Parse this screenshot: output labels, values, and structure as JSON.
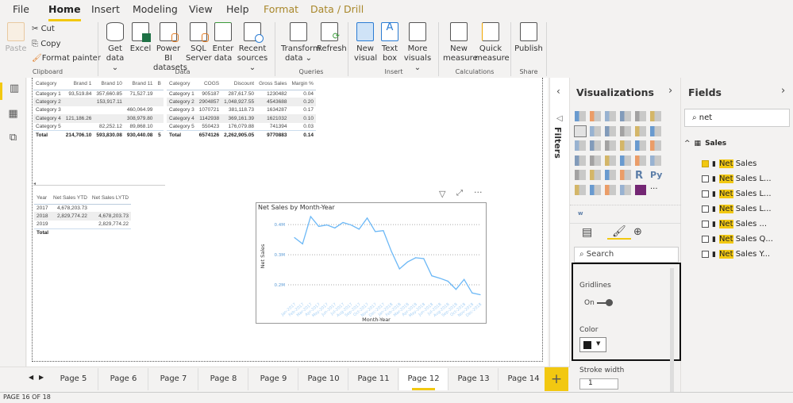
{
  "ribbon": {
    "tabs": [
      "File",
      "Home",
      "Insert",
      "Modeling",
      "View",
      "Help",
      "Format",
      "Data / Drill"
    ],
    "paste": "Paste",
    "cut": "Cut",
    "copy": "Copy",
    "format_painter": "Format painter",
    "buttons": [
      {
        "l1": "Get",
        "l2": "data ⌄"
      },
      {
        "l1": "Excel",
        "l2": ""
      },
      {
        "l1": "Power BI",
        "l2": "datasets"
      },
      {
        "l1": "SQL",
        "l2": "Server"
      },
      {
        "l1": "Enter",
        "l2": "data"
      },
      {
        "l1": "Recent",
        "l2": "sources ⌄"
      },
      {
        "l1": "Transform",
        "l2": "data ⌄"
      },
      {
        "l1": "Refresh",
        "l2": ""
      },
      {
        "l1": "New",
        "l2": "visual"
      },
      {
        "l1": "Text",
        "l2": "box"
      },
      {
        "l1": "More",
        "l2": "visuals ⌄"
      },
      {
        "l1": "New",
        "l2": "measure"
      },
      {
        "l1": "Quick",
        "l2": "measure"
      },
      {
        "l1": "Publish",
        "l2": ""
      }
    ],
    "groups": [
      "Clipboard",
      "Data",
      "Queries",
      "Insert",
      "Calculations",
      "Share"
    ]
  },
  "table1": {
    "headers": [
      "Category",
      "Brand 1",
      "Brand 10",
      "Brand 11",
      "B"
    ],
    "rows": [
      [
        "Category 1",
        "93,519.84",
        "357,660.85",
        "71,527.19",
        ""
      ],
      [
        "Category 2",
        "",
        "153,917.11",
        "",
        ""
      ],
      [
        "Category 3",
        "",
        "",
        "460,064.99",
        ""
      ],
      [
        "Category 4",
        "121,186.26",
        "",
        "308,979.80",
        ""
      ],
      [
        "Category 5",
        "",
        "82,252.12",
        "89,868.10",
        ""
      ],
      [
        "Total",
        "214,706.10",
        "593,830.08",
        "930,440.08",
        "5"
      ]
    ]
  },
  "table2": {
    "headers": [
      "Category",
      "COGS",
      "Discount",
      "Gross Sales",
      "Margin %"
    ],
    "rows": [
      [
        "Category 1",
        "905187",
        "287,617.50",
        "1230482",
        "0.04"
      ],
      [
        "Category 2",
        "2904857",
        "1,048,927.55",
        "4543688",
        "0.20"
      ],
      [
        "Category 3",
        "1070721",
        "381,118.73",
        "1634287",
        "0.17"
      ],
      [
        "Category 4",
        "1142938",
        "369,161.39",
        "1621032",
        "0.10"
      ],
      [
        "Category 5",
        "550423",
        "176,079.88",
        "741394",
        "0.03"
      ],
      [
        "Total",
        "6574126",
        "2,262,905.05",
        "9770883",
        "0.14"
      ]
    ]
  },
  "table3": {
    "headers": [
      "Year",
      "Net Sales YTD",
      "Net Sales LYTD"
    ],
    "rows": [
      [
        "2017",
        "4,678,203.73",
        ""
      ],
      [
        "2018",
        "2,829,774.22",
        "4,678,203.73"
      ],
      [
        "2019",
        "",
        "2,829,774.22"
      ],
      [
        "Total",
        "",
        ""
      ]
    ]
  },
  "chart_data": {
    "type": "line",
    "title": "Net Sales by Month-Year",
    "xlabel": "Month-Year",
    "ylabel": "Net Sales",
    "categories": [
      "Jan-2017",
      "Feb-2017",
      "Mar-2017",
      "Apr-2017",
      "May-2017",
      "Jun-2017",
      "Jul-2017",
      "Aug-2017",
      "Sep-2017",
      "Oct-2017",
      "Nov-2017",
      "Dec-2017",
      "Jan-2018",
      "Feb-2018",
      "Mar-2018",
      "Apr-2018",
      "May-2018",
      "Jun-2018",
      "Jul-2018",
      "Aug-2018",
      "Sep-2018",
      "Oct-2018",
      "Nov-2018",
      "Dec-2018"
    ],
    "values": [
      357000,
      336000,
      427000,
      394000,
      399000,
      389000,
      407000,
      399000,
      385000,
      422000,
      377000,
      380000,
      311000,
      253000,
      276000,
      290000,
      287000,
      230000,
      222000,
      212000,
      185000,
      218000,
      173000,
      167000
    ],
    "yticks": [
      "0.2M",
      "0.3M",
      "0.4M"
    ],
    "ytick_values": [
      200000,
      300000,
      400000
    ],
    "ylim": [
      150000,
      440000
    ],
    "grid": true,
    "color": "#6cb8f6"
  },
  "filters_label": "Filters",
  "viz": {
    "title": "Visualizations",
    "search": "Search",
    "gridlines": "Gridlines",
    "toggle": "On",
    "color_label": "Color",
    "color_value": "#1b1b1b",
    "stroke_label": "Stroke width",
    "stroke_value": "1"
  },
  "fields": {
    "title": "Fields",
    "search": "net",
    "table": "Sales",
    "items": [
      {
        "hl": "Net",
        "rest": " Sales",
        "checked": true
      },
      {
        "hl": "Net",
        "rest": " Sales L...",
        "checked": false
      },
      {
        "hl": "Net",
        "rest": " Sales L...",
        "checked": false
      },
      {
        "hl": "Net",
        "rest": " Sales L...",
        "checked": false
      },
      {
        "hl": "Net",
        "rest": " Sales ...",
        "checked": false
      },
      {
        "hl": "Net",
        "rest": " Sales Q...",
        "checked": false
      },
      {
        "hl": "Net",
        "rest": " Sales Y...",
        "checked": false
      }
    ]
  },
  "pages": [
    "Page 5",
    "Page 6",
    "Page 7",
    "Page 8",
    "Page 9",
    "Page 10",
    "Page 11",
    "Page 12",
    "Page 13",
    "Page 14"
  ],
  "active_page": "Page 12",
  "status": "PAGE 16 OF 18"
}
